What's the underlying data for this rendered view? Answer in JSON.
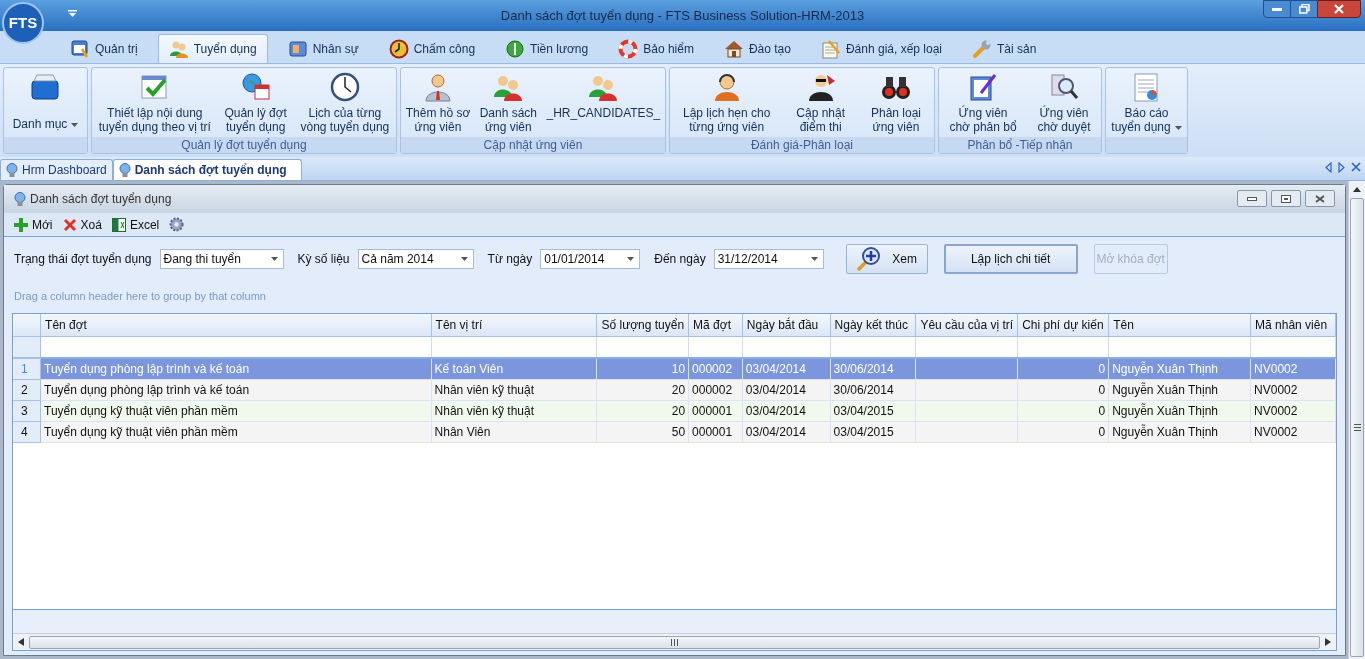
{
  "window": {
    "title": "Danh sách đợt tuyển dụng - FTS Business Solution-HRM-2013",
    "logo": "FTS"
  },
  "ribbon_tabs": [
    {
      "label": "Quản trị",
      "selected": false
    },
    {
      "label": "Tuyển dụng",
      "selected": true
    },
    {
      "label": "Nhân sự",
      "selected": false
    },
    {
      "label": "Chấm công",
      "selected": false
    },
    {
      "label": "Tiền lương",
      "selected": false
    },
    {
      "label": "Bảo hiểm",
      "selected": false
    },
    {
      "label": "Đào tạo",
      "selected": false
    },
    {
      "label": "Đánh giá, xếp loại",
      "selected": false
    },
    {
      "label": "Tài sản",
      "selected": false
    }
  ],
  "ribbon_groups": [
    {
      "buttons": [
        {
          "label": "Danh mục",
          "dropdown": true
        }
      ]
    },
    {
      "label": "Quản lý đợt tuyển dụng",
      "buttons": [
        {
          "label": "Thiết lập nội dung\ntuyển dụng theo vị trí",
          "dropdown": false
        },
        {
          "label": "Quản lý đợt\ntuyển dụng",
          "dropdown": false
        },
        {
          "label": "Lịch của từng\nvòng tuyển dụng",
          "dropdown": false
        }
      ]
    },
    {
      "label": "Cập nhật ứng viên",
      "buttons": [
        {
          "label": "Thêm hồ sơ\nứng viên",
          "dropdown": false
        },
        {
          "label": "Danh sách\nứng viên",
          "dropdown": false
        },
        {
          "label": "_HR_CANDIDATES_",
          "dropdown": false
        }
      ]
    },
    {
      "label": "Đánh giá-Phân loại",
      "buttons": [
        {
          "label": "Lập lịch hẹn cho\ntừng ứng viên",
          "dropdown": false
        },
        {
          "label": "Cập nhật\nđiểm thi",
          "dropdown": false
        },
        {
          "label": "Phân loại\nứng viên",
          "dropdown": false
        }
      ]
    },
    {
      "label": "Phân bổ -Tiếp nhận",
      "buttons": [
        {
          "label": "Ứng viên\nchờ phân bổ",
          "dropdown": false
        },
        {
          "label": "Ứng viên\nchờ duyệt",
          "dropdown": false
        }
      ]
    },
    {
      "buttons": [
        {
          "label": "Báo cáo\ntuyển dụng",
          "dropdown": true
        }
      ]
    }
  ],
  "document_tabs": [
    {
      "label": "Hrm Dashboard",
      "selected": false
    },
    {
      "label": "Danh sách đợt tuyển dụng",
      "selected": true
    }
  ],
  "child_window": {
    "title": "Danh sách đợt tuyển dụng",
    "toolbar": [
      "Mới",
      "Xoá",
      "Excel"
    ],
    "filters": [
      {
        "label": "Trạng thái đợt tuyển dụng",
        "value": "Đang thi tuyển"
      },
      {
        "label": "Kỳ số liệu",
        "value": "Cả năm 2014"
      },
      {
        "label": "Từ ngày",
        "value": "01/01/2014"
      },
      {
        "label": "Đến ngày",
        "value": "31/12/2014"
      }
    ],
    "actions": [
      {
        "label": "Xem",
        "kind": "icon",
        "focused": false,
        "disabled": false
      },
      {
        "label": "Lập lịch chi tiết",
        "kind": "plain",
        "focused": true,
        "disabled": false
      },
      {
        "label": "Mở khóa đợt",
        "kind": "plain",
        "focused": false,
        "disabled": true
      }
    ],
    "group_panel_hint": "Drag a column header here to group by that column",
    "grid": {
      "columns": [
        "Tên đợt",
        "Tên vị trí",
        "Số lượng tuyển",
        "Mã đợt",
        "Ngày bắt đầu",
        "Ngày kết thúc",
        "Yêu cầu của vị trí",
        "Chi phí dự kiến",
        "Tên",
        "Mã nhân viên"
      ],
      "rows": [
        {
          "number": "1",
          "selected": true,
          "cells": [
            "Tuyển dụng phòng lập trình và kế toán",
            "Kế toán Viên",
            "10",
            "000002",
            "03/04/2014",
            "30/06/2014",
            null,
            "0",
            "Nguyễn Xuân Thịnh",
            "NV0002"
          ]
        },
        {
          "number": "2",
          "selected": false,
          "cells": [
            "Tuyển dụng phòng lập trình và kế toán",
            "Nhân viên kỹ thuật",
            "20",
            "000002",
            "03/04/2014",
            "30/06/2014",
            null,
            "0",
            "Nguyễn Xuân Thịnh",
            "NV0002"
          ]
        },
        {
          "number": "3",
          "selected": false,
          "cells": [
            "Tuyển dụng kỹ thuật viên phần mềm",
            "Nhân viên kỹ thuật",
            "20",
            "000001",
            "03/04/2014",
            "03/04/2015",
            null,
            "0",
            "Nguyễn Xuân Thịnh",
            "NV0002"
          ]
        },
        {
          "number": "4",
          "selected": false,
          "cells": [
            "Tuyển dụng kỹ thuật viên phần mềm",
            "Nhân Viên",
            "50",
            "000001",
            "03/04/2014",
            "03/04/2015",
            null,
            "0",
            "Nguyễn Xuân Thịnh",
            "NV0002"
          ]
        }
      ]
    }
  }
}
